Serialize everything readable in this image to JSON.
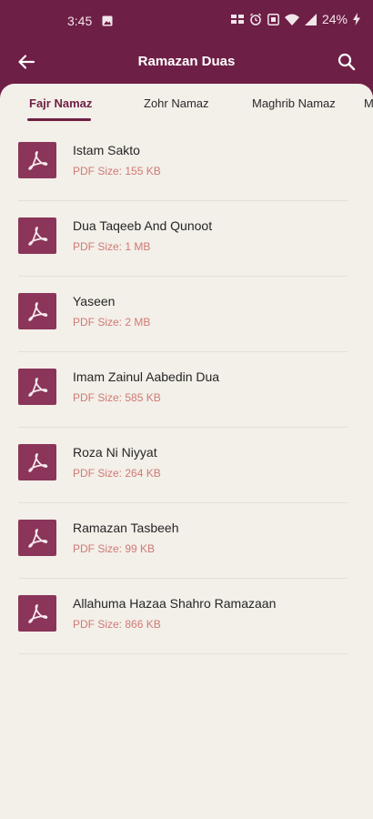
{
  "status_bar": {
    "time": "3:45",
    "battery": "24%"
  },
  "app_bar": {
    "title": "Ramazan Duas",
    "back_icon": "arrow-left-icon",
    "search_icon": "search-icon"
  },
  "tabs": [
    {
      "label": "Fajr Namaz",
      "active": true
    },
    {
      "label": "Zohr Namaz",
      "active": false
    },
    {
      "label": "Maghrib Namaz",
      "active": false
    },
    {
      "label": "M",
      "active": false
    }
  ],
  "items": [
    {
      "title": "Istam Sakto",
      "size": "PDF Size: 155 KB"
    },
    {
      "title": "Dua Taqeeb And Qunoot",
      "size": "PDF Size: 1 MB"
    },
    {
      "title": "Yaseen",
      "size": "PDF Size: 2 MB"
    },
    {
      "title": "Imam Zainul Aabedin Dua",
      "size": "PDF Size: 585 KB"
    },
    {
      "title": "Roza Ni Niyyat",
      "size": "PDF Size: 264 KB"
    },
    {
      "title": "Ramazan Tasbeeh",
      "size": "PDF Size: 99 KB"
    },
    {
      "title": "Allahuma Hazaa Shahro Ramazaan",
      "size": "PDF Size: 866 KB"
    }
  ],
  "colors": {
    "primary": "#6e1f45",
    "thumb": "#8a3559",
    "background": "#f3efe9",
    "size_text": "#d07a74"
  }
}
